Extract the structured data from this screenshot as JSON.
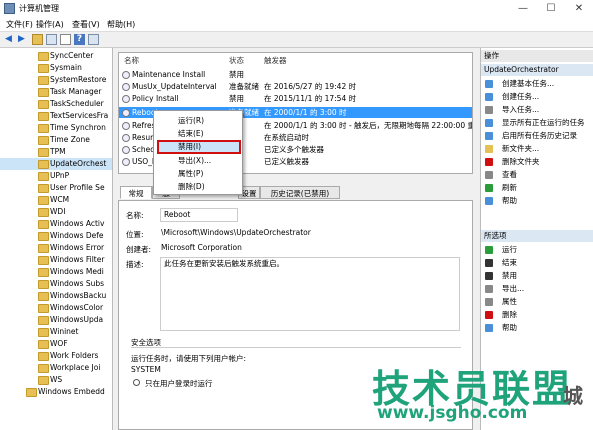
{
  "window": {
    "title": "计算机管理",
    "minimize": "—",
    "maximize": "☐",
    "close": "✕"
  },
  "menu": [
    "文件(F)",
    "操作(A)",
    "查看(V)",
    "帮助(H)"
  ],
  "tree": [
    "SyncCenter",
    "Sysmain",
    "SystemRestore",
    "Task Manager",
    "TaskScheduler",
    "TextServicesFra",
    "Time Synchron",
    "Time Zone",
    "TPM",
    "UpdateOrchest",
    "UPnP",
    "User Profile Se",
    "WCM",
    "WDI",
    "Windows Activ",
    "Windows Defe",
    "Windows Error",
    "Windows Filter",
    "Windows Medi",
    "Windows Subs",
    "WindowsBacku",
    "WindowsColor",
    "WindowsUpda",
    "Wininet",
    "WOF",
    "Work Folders",
    "Workplace Joi",
    "WS",
    "Windows Embedd"
  ],
  "tasklist": {
    "headers": {
      "name": "名称",
      "status": "状态",
      "trigger": "触发器"
    },
    "rows": [
      {
        "name": "Maintenance Install",
        "status": "禁用",
        "trigger": ""
      },
      {
        "name": "MusUx_UpdateInterval",
        "status": "准备就绪",
        "trigger": "在 2016/5/27 的 19:42 时"
      },
      {
        "name": "Policy Install",
        "status": "禁用",
        "trigger": "在 2015/11/1 的 17:54 时"
      },
      {
        "name": "Reboot",
        "status": "准备就绪",
        "trigger": "在 2000/1/1 的 3:00 时"
      },
      {
        "name": "Refresh",
        "status": "",
        "trigger": "在 2000/1/1 的 3:00 时 - 触发后，无限期地每隔 22:00:00 重"
      },
      {
        "name": "Resum",
        "status": "",
        "trigger": "在系统启动时"
      },
      {
        "name": "Sched",
        "status": "",
        "trigger": "已定义多个触发器"
      },
      {
        "name": "USO_R",
        "status": "",
        "trigger": "已定义触发器"
      }
    ]
  },
  "context_menu": [
    "运行(R)",
    "结束(E)",
    "禁用(I)",
    "导出(X)...",
    "属性(P)",
    "删除(D)"
  ],
  "tabs": [
    "常规",
    "触",
    "设置",
    "历史记录(已禁用)"
  ],
  "detail": {
    "name_label": "名称:",
    "name_value": "Reboot",
    "location_label": "位置:",
    "location_value": "\\Microsoft\\Windows\\UpdateOrchestrator",
    "author_label": "创建者:",
    "author_value": "Microsoft Corporation",
    "desc_label": "描述:",
    "desc_value": "此任务在更新安装后触发系统重启。",
    "security_label": "安全选项",
    "run_as_label": "运行任务时，请使用下列用户帐户:",
    "run_as_value": "SYSTEM",
    "radio1": "只在用户登录时运行"
  },
  "actions": {
    "header": "操作",
    "sub1": "UpdateOrchestrator",
    "group1": [
      {
        "label": "创建基本任务...",
        "color": "#4a90d9"
      },
      {
        "label": "创建任务...",
        "color": "#4a90d9"
      },
      {
        "label": "导入任务...",
        "color": "#888888"
      },
      {
        "label": "显示所有正在运行的任务",
        "color": "#4a90d9"
      },
      {
        "label": "启用所有任务历史记录",
        "color": "#4a90d9"
      },
      {
        "label": "新文件夹...",
        "color": "#e6c055"
      },
      {
        "label": "删除文件夹",
        "color": "#d01010"
      },
      {
        "label": "查看",
        "color": "#888888"
      },
      {
        "label": "刷新",
        "color": "#2a9d3a"
      },
      {
        "label": "帮助",
        "color": "#4a90d9"
      }
    ],
    "sub2": "所选项",
    "group2": [
      {
        "label": "运行",
        "color": "#2a9d3a"
      },
      {
        "label": "结束",
        "color": "#333333"
      },
      {
        "label": "禁用",
        "color": "#333333"
      },
      {
        "label": "导出...",
        "color": "#888888"
      },
      {
        "label": "属性",
        "color": "#888888"
      },
      {
        "label": "删除",
        "color": "#d01010"
      },
      {
        "label": "帮助",
        "color": "#4a90d9"
      }
    ]
  },
  "watermark": {
    "main": "技术员联盟",
    "url": "www.jsgho.com",
    "side": "城"
  }
}
